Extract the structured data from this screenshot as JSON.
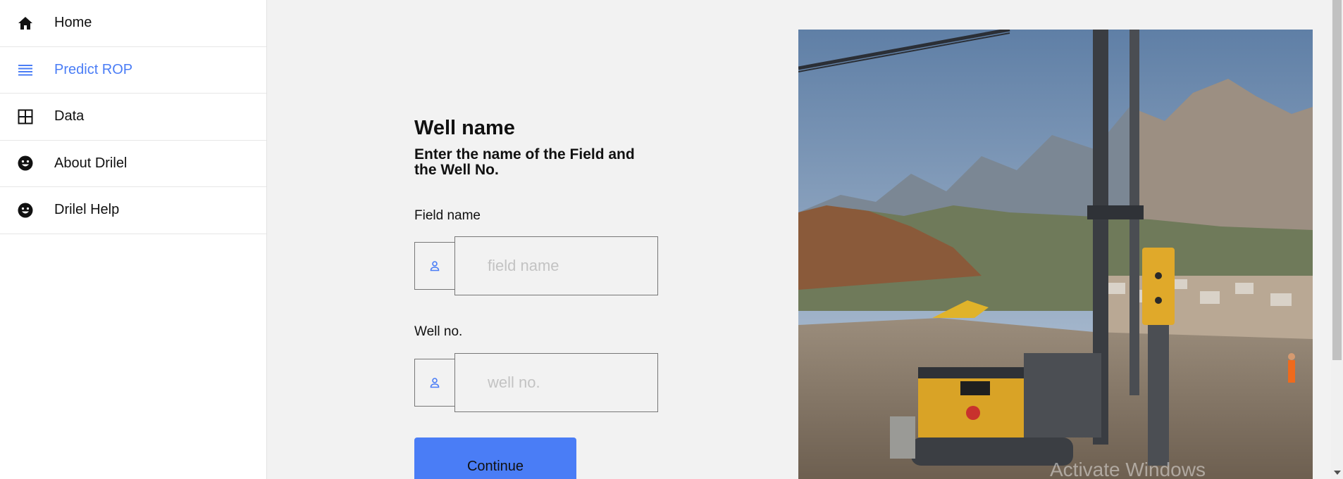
{
  "nav": {
    "items": [
      {
        "label": "Home",
        "icon": "home-icon",
        "active": false
      },
      {
        "label": "Predict ROP",
        "icon": "list-icon",
        "active": true
      },
      {
        "label": "Data",
        "icon": "grid-icon",
        "active": false
      },
      {
        "label": "About Drilel",
        "icon": "smiley-icon",
        "active": false
      },
      {
        "label": "Drilel Help",
        "icon": "smiley-icon",
        "active": false
      }
    ]
  },
  "form": {
    "title": "Well name",
    "subtitle": "Enter the name of the Field and the Well No.",
    "field_name": {
      "label": "Field name",
      "placeholder": "field name",
      "value": ""
    },
    "well_no": {
      "label": "Well no.",
      "placeholder": "well no.",
      "value": ""
    },
    "continue_label": "Continue"
  },
  "watermark": "Activate Windows",
  "colors": {
    "accent": "#4a7df6",
    "background": "#f2f2f2",
    "sidebar": "#ffffff"
  }
}
